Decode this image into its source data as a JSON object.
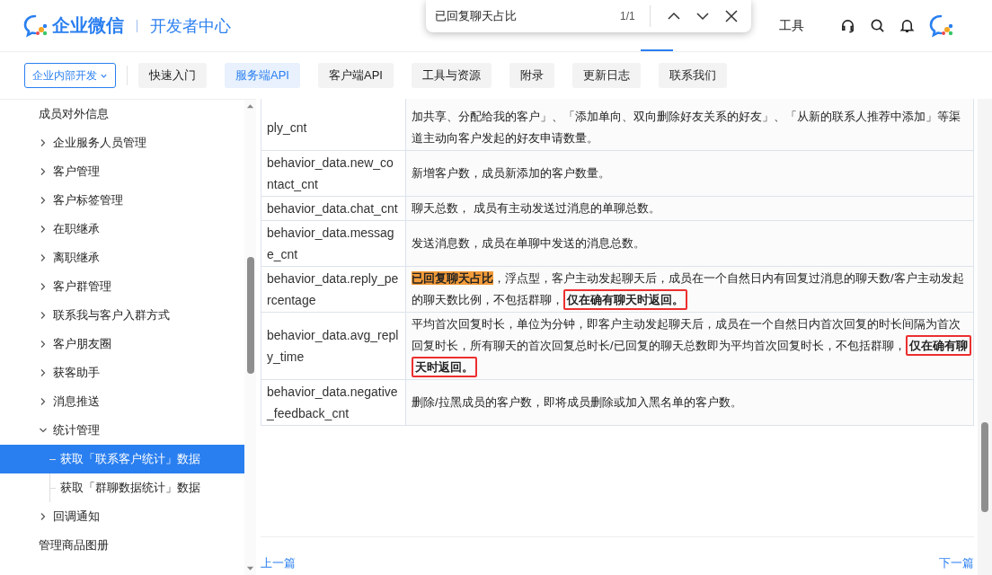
{
  "header": {
    "logo_name": "企业微信",
    "logo_subtitle": "开发者中心",
    "nav_items": [
      {
        "label": "工具",
        "selected": false
      }
    ]
  },
  "find_bar": {
    "value": "已回复聊天占比",
    "count": "1/1"
  },
  "subnav": {
    "dropdown": "企业内部开发",
    "tabs": [
      {
        "label": "快速入门",
        "selected": false
      },
      {
        "label": "服务端API",
        "selected": true
      },
      {
        "label": "客户端API",
        "selected": false
      },
      {
        "label": "工具与资源",
        "selected": false
      },
      {
        "label": "附录",
        "selected": false
      },
      {
        "label": "更新日志",
        "selected": false
      },
      {
        "label": "联系我们",
        "selected": false
      }
    ]
  },
  "sidebar": {
    "items": [
      {
        "label": "成员对外信息",
        "kind": "leaf",
        "selected": false
      },
      {
        "label": "企业服务人员管理",
        "kind": "group",
        "expanded": false
      },
      {
        "label": "客户管理",
        "kind": "group",
        "expanded": false
      },
      {
        "label": "客户标签管理",
        "kind": "group",
        "expanded": false
      },
      {
        "label": "在职继承",
        "kind": "group",
        "expanded": false
      },
      {
        "label": "离职继承",
        "kind": "group",
        "expanded": false
      },
      {
        "label": "客户群管理",
        "kind": "group",
        "expanded": false
      },
      {
        "label": "联系我与客户入群方式",
        "kind": "group",
        "expanded": false
      },
      {
        "label": "客户朋友圈",
        "kind": "group",
        "expanded": false
      },
      {
        "label": "获客助手",
        "kind": "group",
        "expanded": false
      },
      {
        "label": "消息推送",
        "kind": "group",
        "expanded": false
      },
      {
        "label": "统计管理",
        "kind": "group",
        "expanded": true,
        "children": [
          {
            "label": "获取「联系客户统计」数据",
            "selected": true
          },
          {
            "label": "获取「群聊数据统计」数据",
            "selected": false
          }
        ]
      },
      {
        "label": "回调通知",
        "kind": "group",
        "expanded": false
      },
      {
        "label": "管理商品图册",
        "kind": "leaf",
        "selected": false
      }
    ]
  },
  "table": {
    "rows": [
      {
        "field": "ply_cnt",
        "description": [
          {
            "kind": "plain",
            "text": "加共享、分配给我的客户」、「添加单向、双向删除好友关系的好友」、「从新的联系人推荐中添加」等渠道主动向客户发起的好友申请数量。"
          }
        ]
      },
      {
        "field": "behavior_data.new_contact_cnt",
        "description": [
          {
            "kind": "plain",
            "text": "新增客户数，成员新添加的客户数量。"
          }
        ]
      },
      {
        "field": "behavior_data.chat_cnt",
        "description": [
          {
            "kind": "plain",
            "text": "聊天总数， 成员有主动发送过消息的单聊总数。"
          }
        ]
      },
      {
        "field": "behavior_data.message_cnt",
        "description": [
          {
            "kind": "plain",
            "text": "发送消息数，成员在单聊中发送的消息总数。"
          }
        ]
      },
      {
        "field": "behavior_data.reply_percentage",
        "description": [
          {
            "kind": "match",
            "text": "已回复聊天占比"
          },
          {
            "kind": "plain",
            "text": "，浮点型，客户主动发起聊天后，成员在一个自然日内有回复过消息的聊天数/客户主动发起的聊天数比例，不包括群聊，"
          },
          {
            "kind": "boxed",
            "text": "仅在确有聊天时返回。"
          }
        ]
      },
      {
        "field": "behavior_data.avg_reply_time",
        "description": [
          {
            "kind": "plain",
            "text": "平均首次回复时长，单位为分钟，即客户主动发起聊天后，成员在一个自然日内首次回复的时长间隔为首次回复时长，所有聊天的首次回复总时长/已回复的聊天总数即为平均首次回复时长，不包括群聊，"
          },
          {
            "kind": "boxed",
            "text": "仅在确有聊天时返回。"
          }
        ]
      },
      {
        "field": "behavior_data.negative_feedback_cnt",
        "description": [
          {
            "kind": "plain",
            "text": "删除/拉黑成员的客户数，即将成员删除或加入黑名单的客户数。"
          }
        ]
      }
    ]
  },
  "pager": {
    "previous": "上一篇",
    "next": "下一篇"
  }
}
